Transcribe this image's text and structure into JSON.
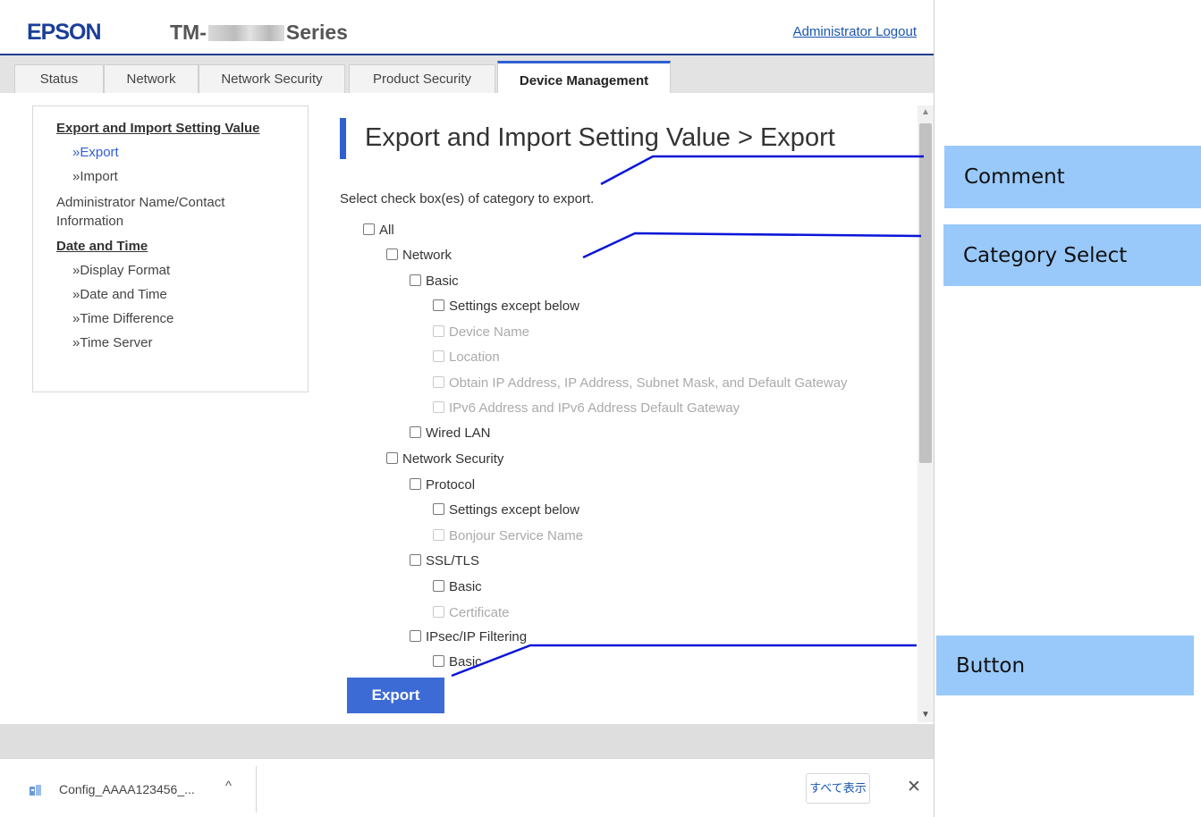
{
  "header": {
    "logo": "EPSON",
    "model_prefix": "TM-",
    "model_suffix": "Series",
    "logout": "Administrator Logout"
  },
  "tabs": [
    {
      "label": "Status",
      "active": false
    },
    {
      "label": "Network",
      "active": false
    },
    {
      "label": "Network Security",
      "active": false
    },
    {
      "label": "Product Security",
      "active": false
    },
    {
      "label": "Device Management",
      "active": true
    }
  ],
  "sidebar": {
    "section1_title": "Export and Import Setting Value",
    "export": "»Export",
    "import": "»Import",
    "admin_line1": "Administrator Name/Contact",
    "admin_line2": "Information",
    "section2_title": "Date and Time",
    "display_format": "»Display Format",
    "date_and_time": "»Date and Time",
    "time_difference": "»Time Difference",
    "time_server": "»Time Server"
  },
  "main": {
    "title": "Export and Import Setting Value > Export",
    "instruction": "Select check box(es) of category to export.",
    "tree": [
      {
        "label": "All",
        "disabled": false
      },
      {
        "label": "Network",
        "disabled": false
      },
      {
        "label": "Basic",
        "disabled": false
      },
      {
        "label": "Settings except below",
        "disabled": false
      },
      {
        "label": "Device Name",
        "disabled": true
      },
      {
        "label": "Location",
        "disabled": true
      },
      {
        "label": "Obtain IP Address, IP Address, Subnet Mask, and Default Gateway",
        "disabled": true
      },
      {
        "label": "IPv6 Address and IPv6 Address Default Gateway",
        "disabled": true
      },
      {
        "label": "Wired LAN",
        "disabled": false
      },
      {
        "label": "Network Security",
        "disabled": false
      },
      {
        "label": "Protocol",
        "disabled": false
      },
      {
        "label": "Settings except below",
        "disabled": false
      },
      {
        "label": "Bonjour Service Name",
        "disabled": true
      },
      {
        "label": "SSL/TLS",
        "disabled": false
      },
      {
        "label": "Basic",
        "disabled": false
      },
      {
        "label": "Certificate",
        "disabled": true
      },
      {
        "label": "IPsec/IP Filtering",
        "disabled": false
      },
      {
        "label": "Basic",
        "disabled": false
      }
    ],
    "export_button": "Export"
  },
  "download_bar": {
    "filename": "Config_AAAA123456_...",
    "chevron": "^",
    "show_all": "すべて表示",
    "close": "✕"
  },
  "annotations": {
    "comment": "Comment",
    "category_select": "Category Select",
    "button": "Button",
    "color": "#99c9fa",
    "line_color": "#0a16d8"
  },
  "colors": {
    "brand": "#1a3f97",
    "accent": "#2f60d1",
    "button": "#3d6bd6"
  }
}
